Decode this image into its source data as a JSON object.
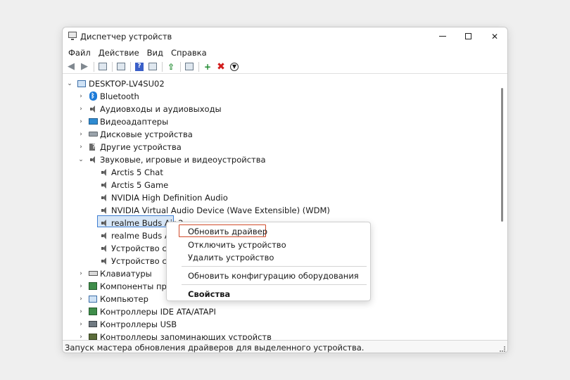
{
  "window": {
    "title": "Диспетчер устройств"
  },
  "menubar": [
    "Файл",
    "Действие",
    "Вид",
    "Справка"
  ],
  "tree": {
    "root": "DESKTOP-LV4SU02",
    "categories": [
      "Bluetooth",
      "Аудиовходы и аудиовыходы",
      "Видеоадаптеры",
      "Дисковые устройства",
      "Другие устройства",
      "Звуковые, игровые и видеоустройства"
    ],
    "sound_devices": [
      "Arctis 5 Chat",
      "Arctis 5 Game",
      "NVIDIA High Definition Audio",
      "NVIDIA Virtual Audio Device (Wave Extensible) (WDM)",
      "realme Buds Air 2",
      "realme Buds Air",
      "Устройство с по",
      "Устройство с по"
    ],
    "more_categories": [
      "Клавиатуры",
      "Компоненты прогр",
      "Компьютер",
      "Контроллеры IDE ATA/ATAPI",
      "Контроллеры USB",
      "Контроллеры запоминающих устройств"
    ]
  },
  "context_menu": {
    "update_driver": "Обновить драйвер",
    "disable_device": "Отключить устройство",
    "uninstall_device": "Удалить устройство",
    "scan_hardware": "Обновить конфигурацию оборудования",
    "properties": "Свойства"
  },
  "statusbar": {
    "text": "Запуск мастера обновления драйверов для выделенного устройства."
  },
  "colors": {
    "selection": "#d8e7f7",
    "selection_border": "#3f7ed2",
    "highlight_outline": "#d04a2a"
  }
}
